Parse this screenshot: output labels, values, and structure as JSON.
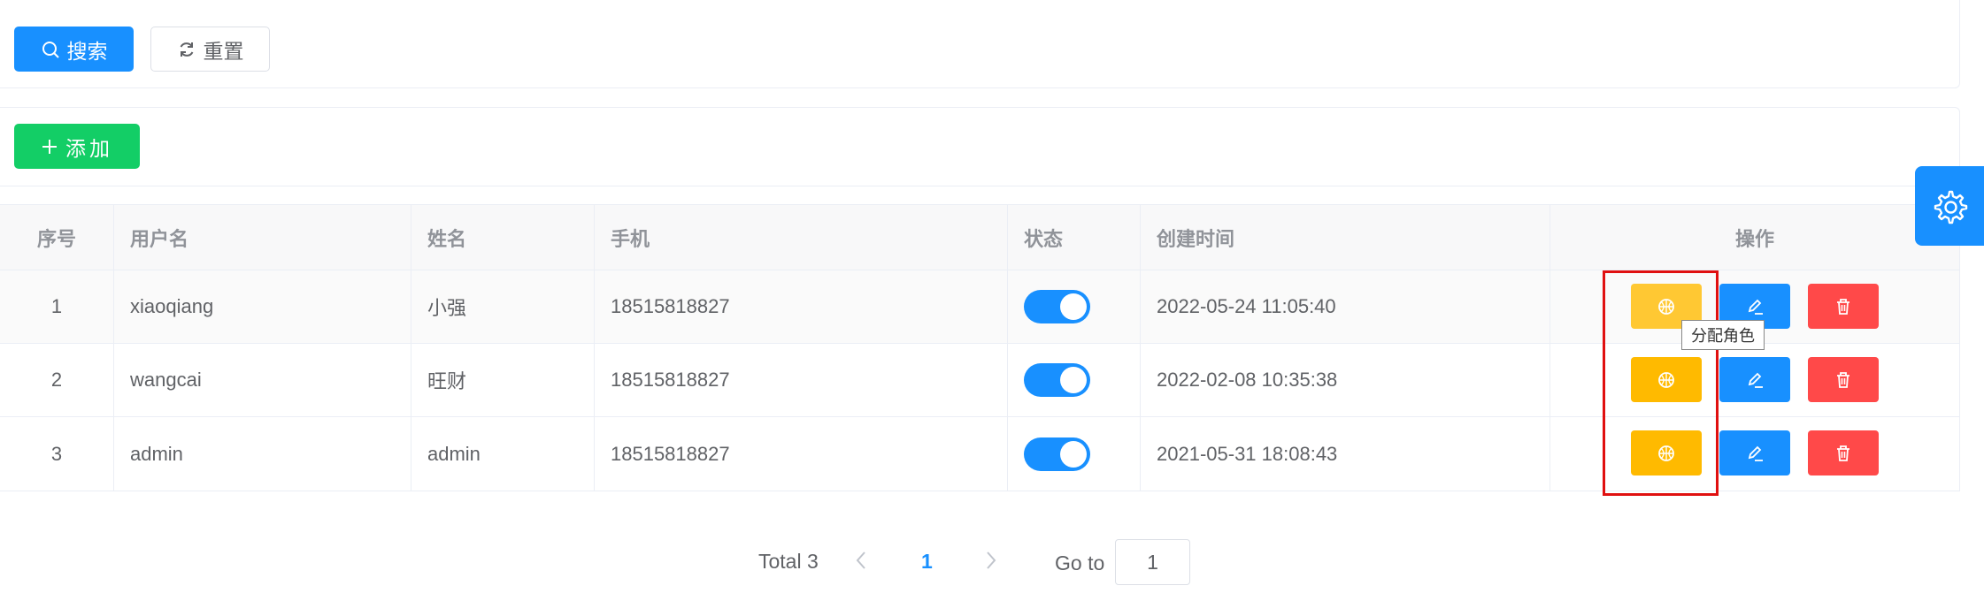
{
  "search": {
    "search_label": "搜索",
    "reset_label": "重置"
  },
  "toolbar": {
    "add_label": "添加"
  },
  "table": {
    "headers": [
      "序号",
      "用户名",
      "姓名",
      "手机",
      "状态",
      "创建时间",
      "操作"
    ],
    "rows": [
      {
        "index": "1",
        "username": "xiaoqiang",
        "name": "小强",
        "phone": "18515818827",
        "status": "on",
        "created": "2022-05-24 11:05:40"
      },
      {
        "index": "2",
        "username": "wangcai",
        "name": "旺财",
        "phone": "18515818827",
        "status": "on",
        "created": "2022-02-08 10:35:38"
      },
      {
        "index": "3",
        "username": "admin",
        "name": "admin",
        "phone": "18515818827",
        "status": "on",
        "created": "2021-05-31 18:08:43"
      }
    ]
  },
  "tooltip": {
    "text": "分配角色"
  },
  "pagination": {
    "total": "Total 3",
    "current_page": "1",
    "goto_label": "Go to",
    "goto_value": "1"
  },
  "colors": {
    "primary": "#1890ff",
    "success": "#13ce66",
    "warning": "#ffba00",
    "danger": "#ff4949",
    "highlight": "#e01010"
  }
}
